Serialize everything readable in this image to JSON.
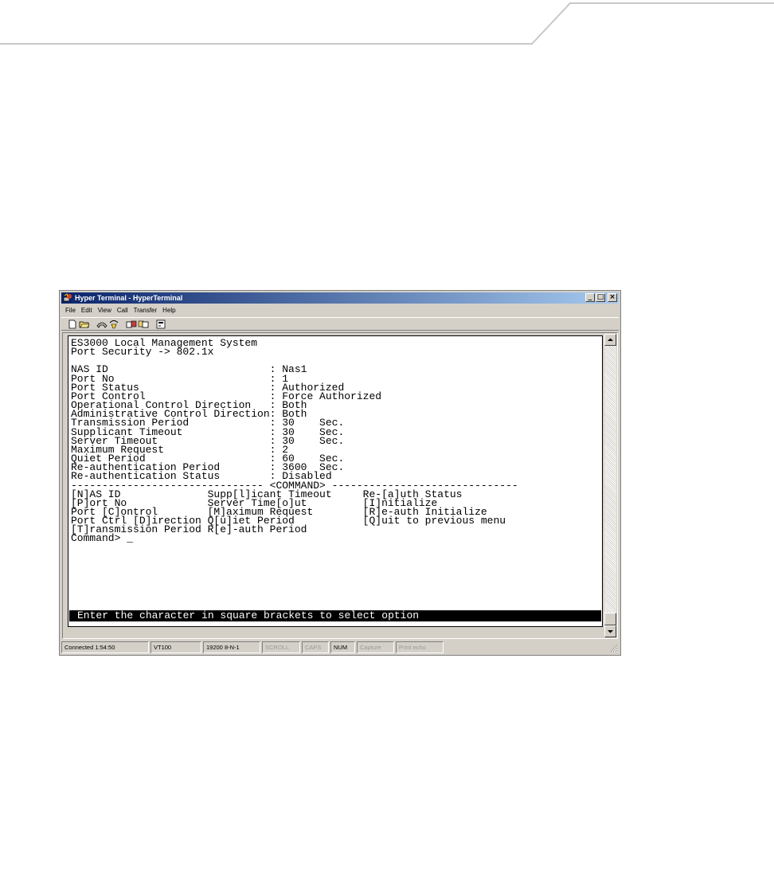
{
  "window": {
    "title": "Hyper Terminal - HyperTerminal",
    "controls": {
      "minimize": "_",
      "maximize": "□",
      "close": "×"
    }
  },
  "menu": [
    "File",
    "Edit",
    "View",
    "Call",
    "Transfer",
    "Help"
  ],
  "toolbar_icons": [
    "new-connection-icon",
    "open-icon",
    "dial-icon",
    "hang-up-icon",
    "send-icon",
    "receive-icon",
    "properties-icon"
  ],
  "terminal": {
    "lines": [
      "ES3000 Local Management System",
      "Port Security -> 802.1x",
      "",
      "NAS ID                          : Nas1",
      "Port No                         : 1",
      "Port Status                     : Authorized",
      "Port Control                    : Force Authorized",
      "Operational Control Direction   : Both",
      "Administrative Control Direction: Both",
      "Transmission Period             : 30    Sec.",
      "Supplicant Timeout              : 30    Sec.",
      "Server Timeout                  : 30    Sec.",
      "Maximum Request                 : 2",
      "Quiet Period                    : 60    Sec.",
      "Re-authentication Period        : 3600  Sec.",
      "Re-authentication Status        : Disabled",
      "------------------------------- <COMMAND> ------------------------------",
      "[N]AS ID              Supp[l]icant Timeout     Re-[a]uth Status",
      "[P]ort No             Server Time[o]ut         [I]nitialize",
      "Port [C]ontrol        [M]aximum Request        [R]e-auth Initialize",
      "Port Ctrl [D]irection Q[u]iet Period           [Q]uit to previous menu",
      "[T]ransmission Period R[e]-auth Period",
      "Command> _"
    ],
    "status_line": "Enter the character in square brackets to select option"
  },
  "statusbar": [
    {
      "text": "Connected 1:54:50",
      "enabled": true
    },
    {
      "text": "VT100",
      "enabled": true
    },
    {
      "text": "19200 8-N-1",
      "enabled": true
    },
    {
      "text": "SCROLL",
      "enabled": false
    },
    {
      "text": "CAPS",
      "enabled": false
    },
    {
      "text": "NUM",
      "enabled": true
    },
    {
      "text": "Capture",
      "enabled": false
    },
    {
      "text": "Print echo",
      "enabled": false
    }
  ]
}
